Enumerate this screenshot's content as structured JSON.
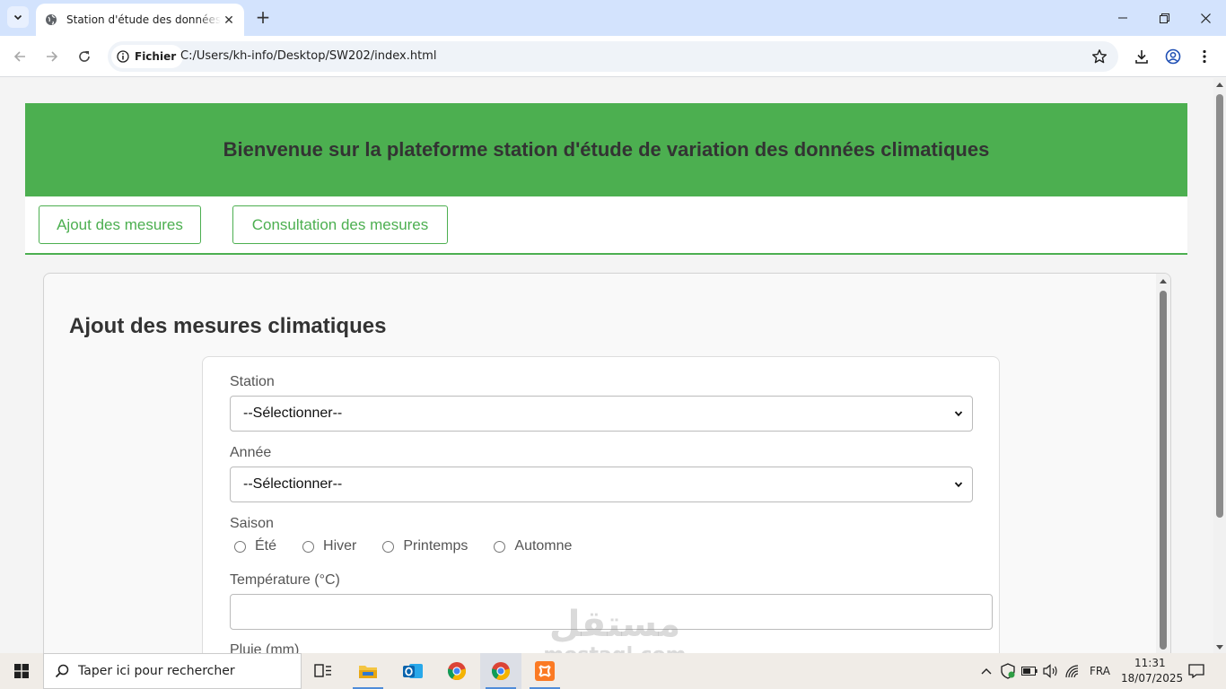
{
  "browser": {
    "tab_title": "Station d'étude des données climatiques",
    "new_tab": "+",
    "close_tab": "✕",
    "site_info_label": "Fichier",
    "url": "C:/Users/kh-info/Desktop/SW202/index.html"
  },
  "page": {
    "header_title": "Bienvenue sur la plateforme station d'étude de variation des données climatiques",
    "nav": [
      "Ajout des mesures",
      "Consultation des mesures"
    ],
    "section_title": "Ajout des mesures climatiques",
    "form": {
      "station_label": "Station",
      "station_value": "--Sélectionner--",
      "annee_label": "Année",
      "annee_value": "--Sélectionner--",
      "saison_label": "Saison",
      "saisons": [
        "Été",
        "Hiver",
        "Printemps",
        "Automne"
      ],
      "temperature_label": "Température (°C)",
      "temperature_value": "",
      "pluie_label": "Pluie (mm)"
    }
  },
  "watermark": {
    "arabic": "مستقل",
    "latin": "mostaql.com"
  },
  "taskbar": {
    "search_placeholder": "Taper ici pour rechercher",
    "language": "FRA",
    "time": "11:31",
    "date": "18/07/2025"
  },
  "colors": {
    "brand_green": "#4caf50",
    "tabbar": "#d3e3fd",
    "taskbar": "#f0ece7"
  }
}
